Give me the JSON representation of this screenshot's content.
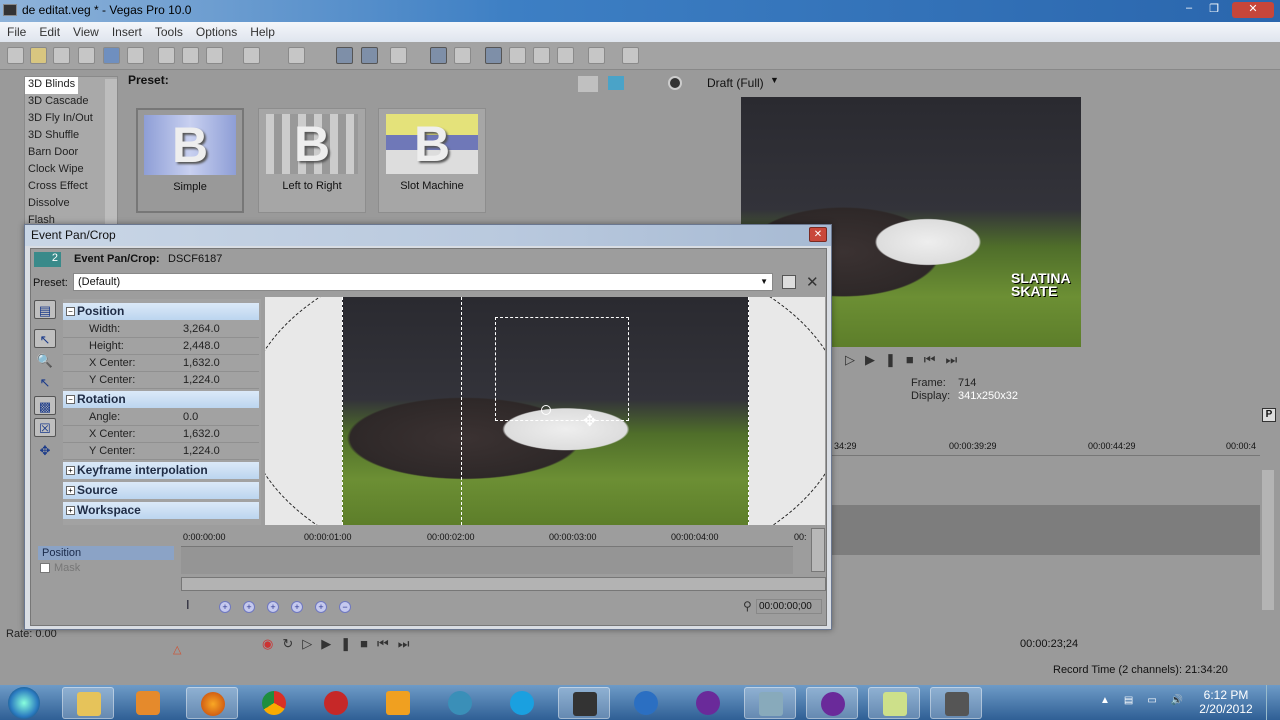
{
  "window": {
    "title": "de editat.veg * - Vegas Pro 10.0",
    "controls": [
      "minimize",
      "restore",
      "close"
    ]
  },
  "menu": [
    "File",
    "Edit",
    "View",
    "Insert",
    "Tools",
    "Options",
    "Help"
  ],
  "toolbar": {
    "icons": [
      "new-icon",
      "open-icon",
      "save-icon",
      "save-as-icon",
      "render-icon",
      "properties-icon",
      "cut-icon",
      "copy-icon",
      "paste-icon",
      "undo-icon",
      "redo-icon",
      "snapping-icon",
      "auto-ripple-icon",
      "lock-envelopes-icon",
      "ignore-grouping-icon",
      "crossfade-icon",
      "normal-edit-icon",
      "envelope-edit-icon",
      "selection-edit-icon",
      "zoom-edit-icon",
      "scrub-icon",
      "help-icon"
    ]
  },
  "transitions": {
    "items": [
      "3D Blinds",
      "3D Cascade",
      "3D Fly In/Out",
      "3D Shuffle",
      "Barn Door",
      "Clock Wipe",
      "Cross Effect",
      "Dissolve",
      "Flash"
    ],
    "selected": "3D Blinds",
    "preset_label": "Preset:",
    "presets": [
      {
        "label": "Simple",
        "glyph": "B"
      },
      {
        "label": "Left to Right",
        "glyph": "B"
      },
      {
        "label": "Slot Machine",
        "glyph": "B"
      }
    ]
  },
  "preview": {
    "quality": "Draft (Full)",
    "frame_label": "Frame:",
    "frame": "714",
    "display_label": "Display:",
    "display": "341x250x32",
    "logo_text": "SLATINA SKATE"
  },
  "timeline": {
    "ruler": [
      "34:29",
      "00:00:39:29",
      "00:00:44:29",
      "00:00:4"
    ],
    "rate": "Rate: 0.00",
    "time": "00:00:23;24",
    "record_time": "Record Time (2 channels): 21:34:20"
  },
  "dialog": {
    "title": "Event Pan/Crop",
    "badge": "2",
    "header_label": "Event Pan/Crop:",
    "header_value": "DSCF6187",
    "preset_label": "Preset:",
    "preset_value": "(Default)",
    "sections": {
      "position": {
        "label": "Position",
        "rows": [
          {
            "k": "Width:",
            "v": "3,264.0"
          },
          {
            "k": "Height:",
            "v": "2,448.0"
          },
          {
            "k": "X Center:",
            "v": "1,632.0"
          },
          {
            "k": "Y Center:",
            "v": "1,224.0"
          }
        ]
      },
      "rotation": {
        "label": "Rotation",
        "rows": [
          {
            "k": "Angle:",
            "v": "0.0"
          },
          {
            "k": "X Center:",
            "v": "1,632.0"
          },
          {
            "k": "Y Center:",
            "v": "1,224.0"
          }
        ]
      },
      "keyframe": "Keyframe interpolation",
      "source": "Source",
      "workspace": "Workspace"
    },
    "ruler": [
      "0:00:00:00",
      "00:00:01:00",
      "00:00:02:00",
      "00:00:03:00",
      "00:00:04:00",
      "00:"
    ],
    "tracks": [
      "Position",
      "Mask"
    ],
    "cursor_time": "00:00:00;00"
  },
  "taskbar": {
    "clock_time": "6:12 PM",
    "clock_date": "2/20/2012",
    "apps": [
      "windows-explorer",
      "media-player",
      "firefox",
      "chrome",
      "burn",
      "winamp",
      "xbs",
      "skype",
      "vegas",
      "itunes",
      "yahoo-messenger",
      "control-panel",
      "yahoo-messenger-2",
      "notes",
      "misc"
    ]
  }
}
